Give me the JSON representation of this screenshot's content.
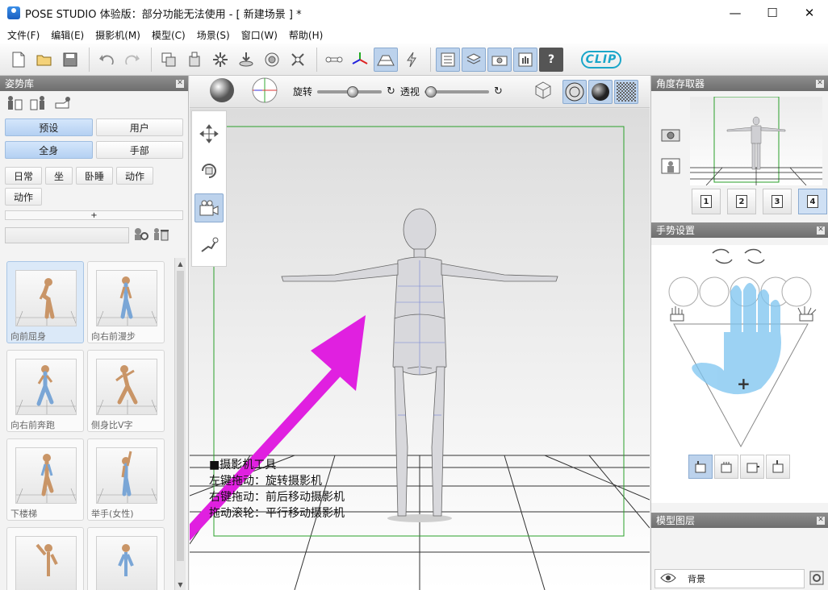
{
  "window": {
    "title": "POSE STUDIO 体验版：部分功能无法使用 - [  新建场景  ] *",
    "minimize": "—",
    "maximize": "☐",
    "close": "✕"
  },
  "menu": [
    "文件(F)",
    "编辑(E)",
    "摄影机(M)",
    "模型(C)",
    "场景(S)",
    "窗口(W)",
    "帮助(H)"
  ],
  "toolbar": {
    "help_label": "?",
    "clip_logo": "CLIP"
  },
  "left_panel": {
    "title": "姿势库",
    "tabs_source": [
      "预设",
      "用户"
    ],
    "tabs_scope": [
      "全身",
      "手部"
    ],
    "categories": [
      "日常",
      "坐",
      "卧睡",
      "动作",
      "动作"
    ],
    "expand_label": "+",
    "search_placeholder": "",
    "poses": [
      "向前屈身",
      "向右前漫步",
      "向右前奔跑",
      "侧身比V字",
      "下楼梯",
      "举手(女性)",
      "",
      ""
    ],
    "scroll_up": "▲",
    "scroll_down": "▼"
  },
  "viewport": {
    "rotate_label": "旋转",
    "perspective_label": "透视",
    "rotate_level": 0.55,
    "perspective_level": 0.1,
    "help_lines": [
      "■摄影机工具",
      "左键拖动：旋转摄影机",
      "右键拖动：前后移动摄影机",
      "拖动滚轮：平行移动摄影机"
    ]
  },
  "right_panel": {
    "angle_title": "角度存取器",
    "slots": [
      "1",
      "2",
      "3",
      "4"
    ],
    "hand_title": "手势设置",
    "center_mark": "+",
    "layer_title": "模型图层",
    "layer_item": "背景"
  },
  "colors": {
    "accent": "#bcd2ec",
    "arrow": "#e020e0",
    "frame_green": "#2aa02a",
    "hand_blue": "#7cc4f0"
  }
}
